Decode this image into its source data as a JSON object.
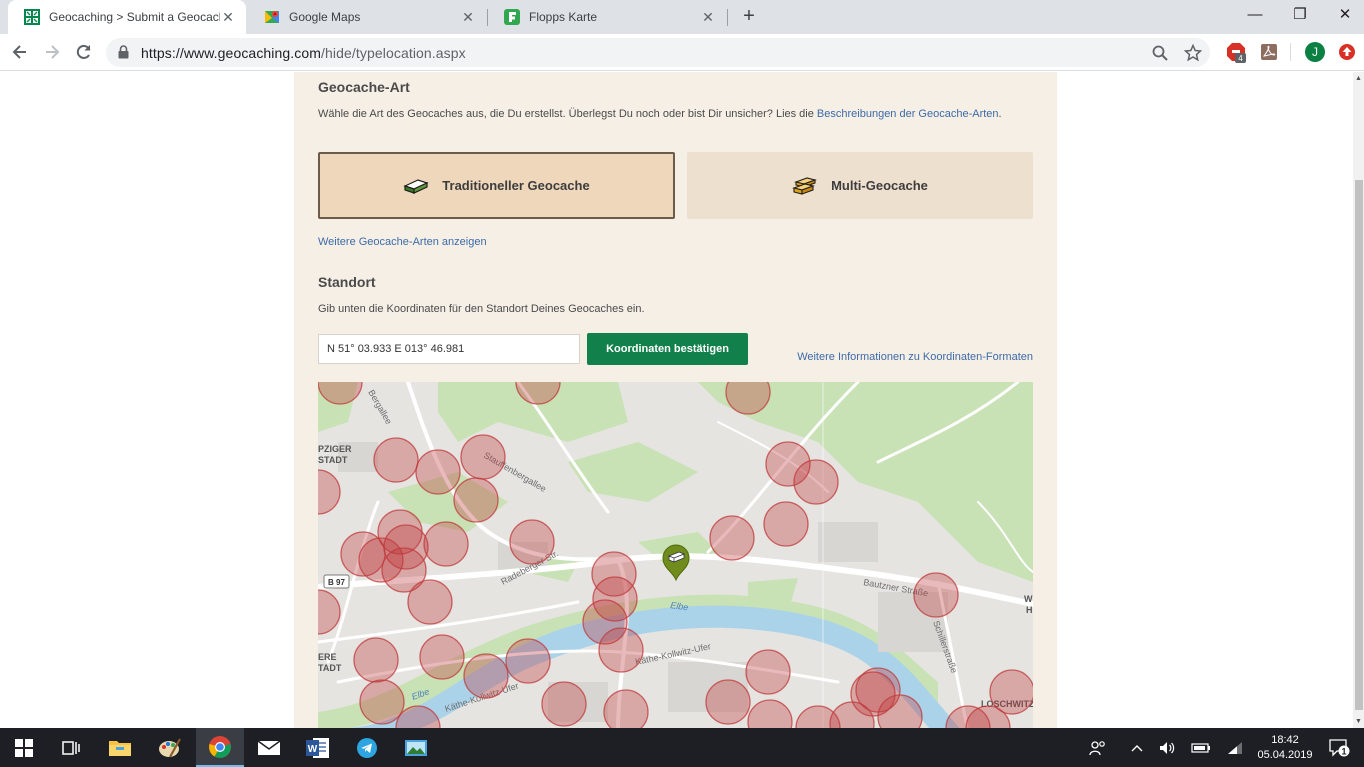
{
  "browser": {
    "tabs": [
      {
        "title": "Geocaching > Submit a Geocach",
        "active": true
      },
      {
        "title": "Google Maps",
        "active": false
      },
      {
        "title": "Flopps Karte",
        "active": false
      }
    ],
    "url_host": "https://www.geocaching.com",
    "url_path": "/hide/typelocation.aspx",
    "profile_initial": "J",
    "extension_badge": "4"
  },
  "page": {
    "type_section": {
      "title": "Geocache-Art",
      "description": "Wähle die Art des Geocaches aus, die Du erstellst. Überlegst Du noch oder bist Dir unsicher? Lies die ",
      "description_link": "Beschreibungen der Geocache-Arten",
      "description_end": ".",
      "options": [
        {
          "label": "Traditioneller Geocache",
          "selected": true,
          "icon": "traditional-cache-icon"
        },
        {
          "label": "Multi-Geocache",
          "selected": false,
          "icon": "multi-cache-icon"
        }
      ],
      "more_types_link": "Weitere Geocache-Arten anzeigen"
    },
    "location_section": {
      "title": "Standort",
      "description": "Gib unten die Koordinaten für den Standort Deines Geocaches ein.",
      "coordinates_value": "N 51° 03.933 E 013° 46.981",
      "confirm_button": "Koordinaten bestätigen",
      "formats_link": "Weitere Informationen zu Koordinaten-Formaten"
    },
    "map": {
      "labels": {
        "river": "Elbe",
        "river2": "Elbe",
        "street1": "Radeberger Str.",
        "street2": "Bautzner Straße",
        "street3": "Käthe-Kollwitz-Ufer",
        "street4": "Käthe-Kollwitz-Ufer",
        "street5": "Schillerstraße",
        "street6": "Stauffenbergallee",
        "street7": "Bergallee",
        "road_badge": "B 97",
        "district1": "PZIGER",
        "district1b": "STADT",
        "district2": "ERE",
        "district2b": "TADT",
        "district3": "LOSCHWITZ",
        "district4": "W",
        "district4b": "H"
      },
      "colors": {
        "cache_circle_fill": "#c0393b",
        "water": "#aad3ea",
        "park": "#c8e1b5",
        "marker": "#6f8c1c"
      }
    }
  },
  "taskbar": {
    "time": "18:42",
    "date": "05.04.2019",
    "notification_count": "1"
  }
}
